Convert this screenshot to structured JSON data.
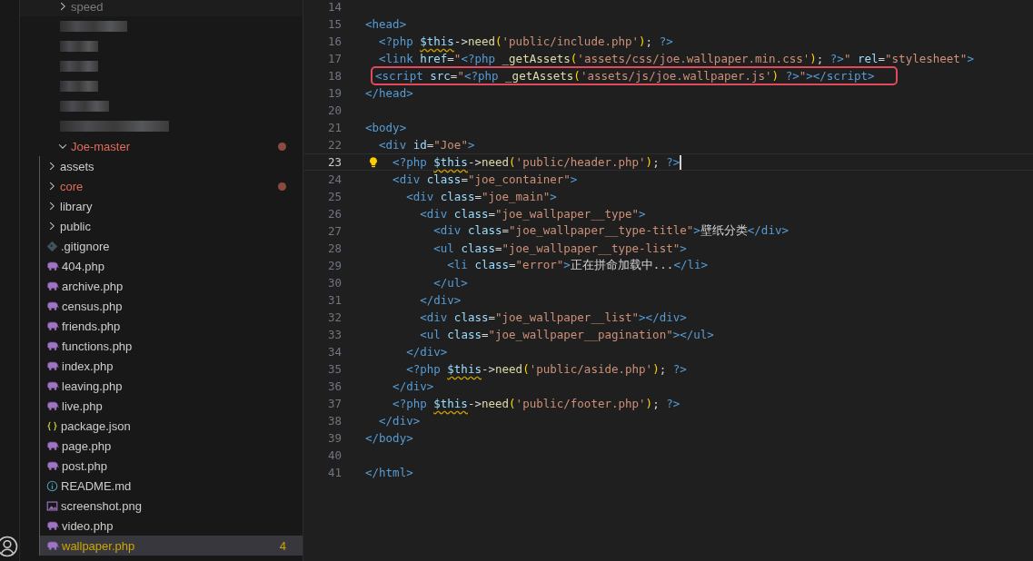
{
  "explorer": {
    "items": [
      {
        "name": "speed",
        "kind": "folder",
        "expanded": false,
        "selected": false
      },
      {
        "kind": "redacted"
      },
      {
        "kind": "redacted"
      },
      {
        "kind": "redacted"
      },
      {
        "kind": "redacted"
      },
      {
        "kind": "redacted"
      },
      {
        "kind": "redacted"
      },
      {
        "name": "Joe-master",
        "kind": "folder",
        "expanded": true,
        "selected": false,
        "modified": true,
        "children": [
          {
            "name": "assets",
            "kind": "folder",
            "expanded": false,
            "selected": false
          },
          {
            "name": "core",
            "kind": "folder",
            "expanded": false,
            "selected": false,
            "modified": true
          },
          {
            "name": "library",
            "kind": "folder",
            "expanded": false,
            "selected": false
          },
          {
            "name": "public",
            "kind": "folder",
            "expanded": false,
            "selected": false
          },
          {
            "name": ".gitignore",
            "kind": "git",
            "selected": false
          },
          {
            "name": "404.php",
            "kind": "php",
            "selected": false
          },
          {
            "name": "archive.php",
            "kind": "php",
            "selected": false
          },
          {
            "name": "census.php",
            "kind": "php",
            "selected": false
          },
          {
            "name": "friends.php",
            "kind": "php",
            "selected": false
          },
          {
            "name": "functions.php",
            "kind": "php",
            "selected": false
          },
          {
            "name": "index.php",
            "kind": "php",
            "selected": false
          },
          {
            "name": "leaving.php",
            "kind": "php",
            "selected": false
          },
          {
            "name": "live.php",
            "kind": "php",
            "selected": false
          },
          {
            "name": "package.json",
            "kind": "json",
            "selected": false
          },
          {
            "name": "page.php",
            "kind": "php",
            "selected": false
          },
          {
            "name": "post.php",
            "kind": "php",
            "selected": false
          },
          {
            "name": "README.md",
            "kind": "info",
            "selected": false
          },
          {
            "name": "screenshot.png",
            "kind": "image",
            "selected": false
          },
          {
            "name": "video.php",
            "kind": "php",
            "selected": false
          },
          {
            "name": "wallpaper.php",
            "kind": "php",
            "selected": true,
            "warning": true,
            "badge": "4"
          }
        ]
      }
    ]
  },
  "editor": {
    "lines": [
      {
        "n": "14"
      },
      {
        "n": "15",
        "tokens": [
          {
            "kind": "tag",
            "text": "<head>"
          }
        ]
      },
      {
        "n": "16",
        "tokens": [
          {
            "kind": "tag",
            "text": "  <?php "
          },
          {
            "kind": "var",
            "text": "$this"
          },
          {
            "kind": "text",
            "text": "->"
          },
          {
            "kind": "fn",
            "text": "need"
          },
          {
            "kind": "paren",
            "text": "("
          },
          {
            "kind": "str",
            "text": "'public/include.php'"
          },
          {
            "kind": "paren",
            "text": ")"
          },
          {
            "kind": "text",
            "text": "; "
          },
          {
            "kind": "tag",
            "text": "?>"
          }
        ]
      },
      {
        "n": "17",
        "tokens": [
          {
            "kind": "tag",
            "text": "  <link "
          },
          {
            "kind": "attr",
            "text": "href"
          },
          {
            "kind": "text",
            "text": "="
          },
          {
            "kind": "str",
            "text": "\""
          },
          {
            "kind": "tag",
            "text": "<?php"
          },
          {
            "kind": "fn",
            "text": " _getAssets"
          },
          {
            "kind": "paren",
            "text": "("
          },
          {
            "kind": "str",
            "text": "'assets/css/joe.wallpaper.min.css'"
          },
          {
            "kind": "paren",
            "text": ")"
          },
          {
            "kind": "text",
            "text": "; "
          },
          {
            "kind": "tag",
            "text": "?>"
          },
          {
            "kind": "str",
            "text": "\""
          },
          {
            "kind": "attr",
            "text": " rel"
          },
          {
            "kind": "text",
            "text": "="
          },
          {
            "kind": "str",
            "text": "\"stylesheet\""
          },
          {
            "kind": "tag",
            "text": ">"
          }
        ]
      },
      {
        "n": "18",
        "boxed": true,
        "tokens": [
          {
            "kind": "tag",
            "text": "  <script "
          },
          {
            "kind": "attr",
            "text": "src"
          },
          {
            "kind": "text",
            "text": "="
          },
          {
            "kind": "str",
            "text": "\""
          },
          {
            "kind": "tag",
            "text": "<?php"
          },
          {
            "kind": "fn",
            "text": " _getAssets"
          },
          {
            "kind": "paren",
            "text": "("
          },
          {
            "kind": "str",
            "text": "'assets/js/joe.wallpaper.js'"
          },
          {
            "kind": "paren",
            "text": ")"
          },
          {
            "kind": "tag",
            "text": " ?>"
          },
          {
            "kind": "str",
            "text": "\""
          },
          {
            "kind": "tag",
            "text": "></script>"
          }
        ]
      },
      {
        "n": "19",
        "tokens": [
          {
            "kind": "tag",
            "text": "</head>"
          }
        ]
      },
      {
        "n": "20"
      },
      {
        "n": "21",
        "tokens": [
          {
            "kind": "tag",
            "text": "<body>"
          }
        ]
      },
      {
        "n": "22",
        "tokens": [
          {
            "kind": "tag",
            "text": "  <div "
          },
          {
            "kind": "attr",
            "text": "id"
          },
          {
            "kind": "text",
            "text": "="
          },
          {
            "kind": "str",
            "text": "\"Joe\""
          },
          {
            "kind": "tag",
            "text": ">"
          }
        ]
      },
      {
        "n": "23",
        "active": true,
        "hint": true,
        "cursor": true,
        "tokens": [
          {
            "kind": "tag",
            "text": "    <?php "
          },
          {
            "kind": "var",
            "text": "$this"
          },
          {
            "kind": "text",
            "text": "->"
          },
          {
            "kind": "fn",
            "text": "need"
          },
          {
            "kind": "paren",
            "text": "("
          },
          {
            "kind": "str",
            "text": "'public/header.php'"
          },
          {
            "kind": "paren",
            "text": ")"
          },
          {
            "kind": "text",
            "text": "; "
          },
          {
            "kind": "tag",
            "text": "?>"
          }
        ]
      },
      {
        "n": "24",
        "tokens": [
          {
            "kind": "tag",
            "text": "    <div "
          },
          {
            "kind": "attr",
            "text": "class"
          },
          {
            "kind": "text",
            "text": "="
          },
          {
            "kind": "str",
            "text": "\"joe_container\""
          },
          {
            "kind": "tag",
            "text": ">"
          }
        ]
      },
      {
        "n": "25",
        "tokens": [
          {
            "kind": "tag",
            "text": "      <div "
          },
          {
            "kind": "attr",
            "text": "class"
          },
          {
            "kind": "text",
            "text": "="
          },
          {
            "kind": "str",
            "text": "\"joe_main\""
          },
          {
            "kind": "tag",
            "text": ">"
          }
        ]
      },
      {
        "n": "26",
        "tokens": [
          {
            "kind": "tag",
            "text": "        <div "
          },
          {
            "kind": "attr",
            "text": "class"
          },
          {
            "kind": "text",
            "text": "="
          },
          {
            "kind": "str",
            "text": "\"joe_wallpaper__type\""
          },
          {
            "kind": "tag",
            "text": ">"
          }
        ]
      },
      {
        "n": "27",
        "tokens": [
          {
            "kind": "tag",
            "text": "          <div "
          },
          {
            "kind": "attr",
            "text": "class"
          },
          {
            "kind": "text",
            "text": "="
          },
          {
            "kind": "str",
            "text": "\"joe_wallpaper__type-title\""
          },
          {
            "kind": "tag",
            "text": ">"
          },
          {
            "kind": "text",
            "text": "壁纸分类"
          },
          {
            "kind": "tag",
            "text": "</div>"
          }
        ]
      },
      {
        "n": "28",
        "tokens": [
          {
            "kind": "tag",
            "text": "          <ul "
          },
          {
            "kind": "attr",
            "text": "class"
          },
          {
            "kind": "text",
            "text": "="
          },
          {
            "kind": "str",
            "text": "\"joe_wallpaper__type-list\""
          },
          {
            "kind": "tag",
            "text": ">"
          }
        ]
      },
      {
        "n": "29",
        "tokens": [
          {
            "kind": "tag",
            "text": "            <li "
          },
          {
            "kind": "attr",
            "text": "class"
          },
          {
            "kind": "text",
            "text": "="
          },
          {
            "kind": "str",
            "text": "\"error\""
          },
          {
            "kind": "tag",
            "text": ">"
          },
          {
            "kind": "text",
            "text": "正在拼命加载中..."
          },
          {
            "kind": "tag",
            "text": "</li>"
          }
        ]
      },
      {
        "n": "30",
        "tokens": [
          {
            "kind": "tag",
            "text": "          </ul>"
          }
        ]
      },
      {
        "n": "31",
        "tokens": [
          {
            "kind": "tag",
            "text": "        </div>"
          }
        ]
      },
      {
        "n": "32",
        "tokens": [
          {
            "kind": "tag",
            "text": "        <div "
          },
          {
            "kind": "attr",
            "text": "class"
          },
          {
            "kind": "text",
            "text": "="
          },
          {
            "kind": "str",
            "text": "\"joe_wallpaper__list\""
          },
          {
            "kind": "tag",
            "text": "></div>"
          }
        ]
      },
      {
        "n": "33",
        "tokens": [
          {
            "kind": "tag",
            "text": "        <ul "
          },
          {
            "kind": "attr",
            "text": "class"
          },
          {
            "kind": "text",
            "text": "="
          },
          {
            "kind": "str",
            "text": "\"joe_wallpaper__pagination\""
          },
          {
            "kind": "tag",
            "text": "></ul>"
          }
        ]
      },
      {
        "n": "34",
        "tokens": [
          {
            "kind": "tag",
            "text": "      </div>"
          }
        ]
      },
      {
        "n": "35",
        "tokens": [
          {
            "kind": "tag",
            "text": "      <?php "
          },
          {
            "kind": "var",
            "text": "$this"
          },
          {
            "kind": "text",
            "text": "->"
          },
          {
            "kind": "fn",
            "text": "need"
          },
          {
            "kind": "paren",
            "text": "("
          },
          {
            "kind": "str",
            "text": "'public/aside.php'"
          },
          {
            "kind": "paren",
            "text": ")"
          },
          {
            "kind": "text",
            "text": "; "
          },
          {
            "kind": "tag",
            "text": "?>"
          }
        ]
      },
      {
        "n": "36",
        "tokens": [
          {
            "kind": "tag",
            "text": "    </div>"
          }
        ]
      },
      {
        "n": "37",
        "tokens": [
          {
            "kind": "tag",
            "text": "    <?php "
          },
          {
            "kind": "var",
            "text": "$this"
          },
          {
            "kind": "text",
            "text": "->"
          },
          {
            "kind": "fn",
            "text": "need"
          },
          {
            "kind": "paren",
            "text": "("
          },
          {
            "kind": "str",
            "text": "'public/footer.php'"
          },
          {
            "kind": "paren",
            "text": ")"
          },
          {
            "kind": "text",
            "text": "; "
          },
          {
            "kind": "tag",
            "text": "?>"
          }
        ]
      },
      {
        "n": "38",
        "tokens": [
          {
            "kind": "tag",
            "text": "  </div>"
          }
        ]
      },
      {
        "n": "39",
        "tokens": [
          {
            "kind": "tag",
            "text": "</body>"
          }
        ]
      },
      {
        "n": "40"
      },
      {
        "n": "41",
        "tokens": [
          {
            "kind": "tag",
            "text": "</html>"
          }
        ]
      }
    ]
  }
}
